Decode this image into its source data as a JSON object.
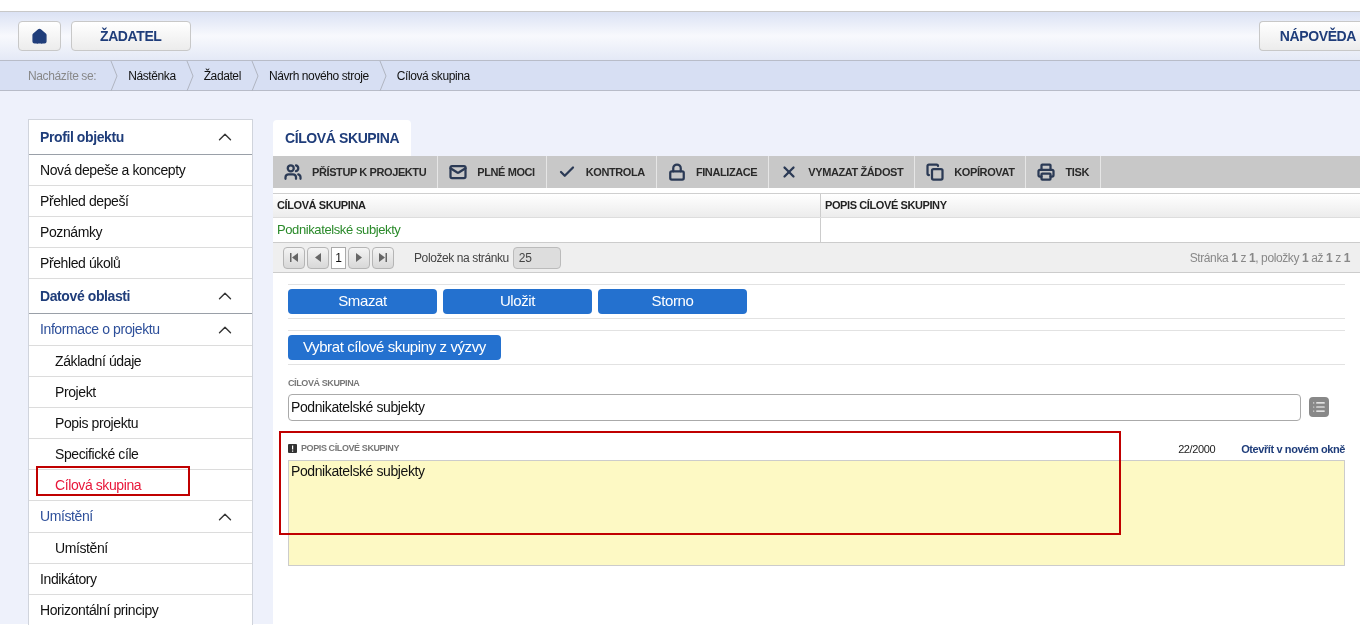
{
  "header": {
    "applicant_button": "ŽADATEL",
    "help_button": "NÁPOVĚDA"
  },
  "breadcrumb": {
    "label": "Nacházíte se:",
    "items": [
      "Nástěnka",
      "Žadatel",
      "Návrh nového stroje",
      "Cílová skupina"
    ]
  },
  "sidebar": [
    {
      "kind": "section",
      "label": "Profil objektu",
      "expanded": true,
      "children": [
        {
          "kind": "link",
          "label": "Nová depeše a koncepty",
          "selected": false,
          "highlighted": false
        },
        {
          "kind": "link",
          "label": "Přehled depeší",
          "selected": false,
          "highlighted": false
        },
        {
          "kind": "link",
          "label": "Poznámky",
          "selected": false,
          "highlighted": false
        },
        {
          "kind": "link",
          "label": "Přehled úkolů",
          "selected": false,
          "highlighted": false
        }
      ]
    },
    {
      "kind": "section",
      "label": "Datové oblasti",
      "expanded": true,
      "children": [
        {
          "kind": "group",
          "label": "Informace o projektu",
          "expanded": true,
          "children": [
            {
              "kind": "link",
              "label": "Základní údaje",
              "selected": false,
              "highlighted": false
            },
            {
              "kind": "link",
              "label": "Projekt",
              "selected": false,
              "highlighted": false
            },
            {
              "kind": "link",
              "label": "Popis projektu",
              "selected": false,
              "highlighted": false
            },
            {
              "kind": "link",
              "label": "Specifické cíle",
              "selected": false,
              "highlighted": false
            },
            {
              "kind": "link",
              "label": "Cílová skupina",
              "selected": true,
              "highlighted": true
            }
          ]
        },
        {
          "kind": "group",
          "label": "Umístění",
          "expanded": true,
          "children": [
            {
              "kind": "link",
              "label": "Umístění",
              "selected": false,
              "highlighted": false
            }
          ]
        },
        {
          "kind": "link",
          "label": "Indikátory",
          "selected": false,
          "highlighted": false
        },
        {
          "kind": "link",
          "label": "Horizontální principy",
          "selected": false,
          "highlighted": false
        }
      ]
    }
  ],
  "tabs": [
    {
      "label": "CÍLOVÁ SKUPINA",
      "selected": true
    }
  ],
  "toolbar": [
    {
      "kind": "people",
      "label": "PŘÍSTUP K PROJEKTU"
    },
    {
      "kind": "mail",
      "label": "PLNÉ MOCI"
    },
    {
      "kind": "check",
      "label": "KONTROLA"
    },
    {
      "kind": "lock",
      "label": "FINALIZACE"
    },
    {
      "kind": "delete",
      "label": "VYMAZAT ŽÁDOST"
    },
    {
      "kind": "copy",
      "label": "KOPÍROVAT"
    },
    {
      "kind": "print",
      "label": "TISK"
    }
  ],
  "table": {
    "columns": [
      "CÍLOVÁ SKUPINA",
      "POPIS CÍLOVÉ SKUPINY"
    ],
    "rows": [
      {
        "cells": [
          "Podnikatelské subjekty",
          ""
        ],
        "selected": false
      }
    ]
  },
  "pager": {
    "page": "1",
    "page_size_label": "Položek na stránku",
    "page_size": "25",
    "summary": "Stránka **1** z **1**, položky **1** až **1** z **1**"
  },
  "actions": [
    "Smazat",
    "Uložit",
    "Storno"
  ],
  "select_button": "Vybrat cílové skupiny z výzvy",
  "target_group_field": {
    "label": "CÍLOVÁ SKUPINA",
    "value": "Podnikatelské subjekty"
  },
  "description_field": {
    "label": "POPIS CÍLOVÉ SKUPINY",
    "required": true,
    "counter": "22/2000",
    "open_link": "Otevřít v novém okně",
    "value": "Podnikatelské subjekty",
    "highlighted": true
  }
}
